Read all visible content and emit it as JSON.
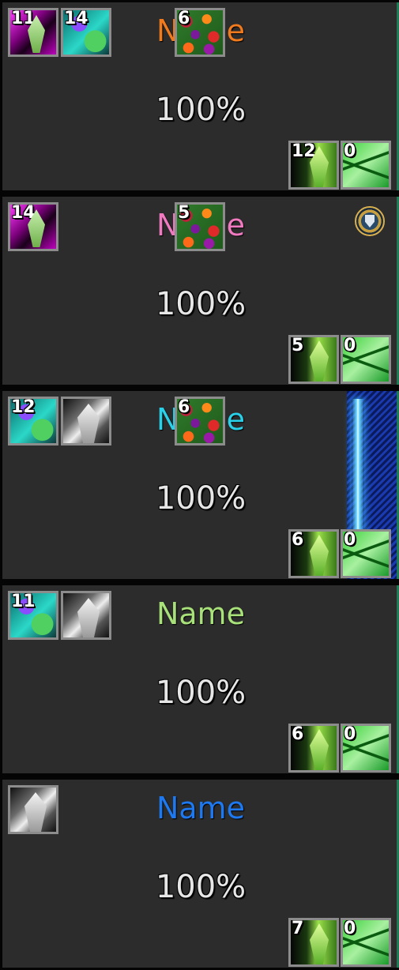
{
  "frames": [
    {
      "name": "Name",
      "name_color": "#f07a1e",
      "health": "100%",
      "debuffs": [
        {
          "stack": "11",
          "icon": "purple-thorns-icon"
        },
        {
          "stack": "14",
          "icon": "teal-bloom-icon"
        }
      ],
      "center_aura": {
        "stack": "6",
        "icon": "flowers-icon"
      },
      "bottom_auras": [
        {
          "stack": "12",
          "icon": "green-thorns-icon"
        },
        {
          "stack": "0",
          "icon": "leaves-icon"
        }
      ]
    },
    {
      "name": "Name",
      "name_color": "#f07ac0",
      "health": "100%",
      "debuffs": [
        {
          "stack": "14",
          "icon": "purple-thorns-icon"
        }
      ],
      "center_aura": {
        "stack": "5",
        "icon": "flowers-icon"
      },
      "buff_icon": "shield-icon",
      "bottom_auras": [
        {
          "stack": "5",
          "icon": "green-thorns-icon"
        },
        {
          "stack": "0",
          "icon": "leaves-icon"
        }
      ]
    },
    {
      "name": "Name",
      "name_color": "#2ad0e8",
      "health": "100%",
      "debuffs": [
        {
          "stack": "12",
          "icon": "teal-bloom-icon"
        },
        {
          "stack": "",
          "icon": "gray-thorns-icon"
        }
      ],
      "center_aura": {
        "stack": "6",
        "icon": "flowers-icon"
      },
      "bottom_auras": [
        {
          "stack": "6",
          "icon": "green-thorns-icon"
        },
        {
          "stack": "0",
          "icon": "leaves-icon"
        }
      ]
    },
    {
      "name": "Name",
      "name_color": "#a8e07a",
      "health": "100%",
      "debuffs": [
        {
          "stack": "11",
          "icon": "teal-bloom-icon"
        },
        {
          "stack": "",
          "icon": "gray-thorns-icon"
        }
      ],
      "bottom_auras": [
        {
          "stack": "6",
          "icon": "green-thorns-icon"
        },
        {
          "stack": "0",
          "icon": "leaves-icon"
        }
      ]
    },
    {
      "name": "Name",
      "name_color": "#1e78f0",
      "health": "100%",
      "debuffs": [
        {
          "stack": "",
          "icon": "gray-thorns-icon"
        }
      ],
      "bottom_auras": [
        {
          "stack": "7",
          "icon": "green-thorns-icon"
        },
        {
          "stack": "0",
          "icon": "leaves-icon"
        }
      ]
    }
  ]
}
